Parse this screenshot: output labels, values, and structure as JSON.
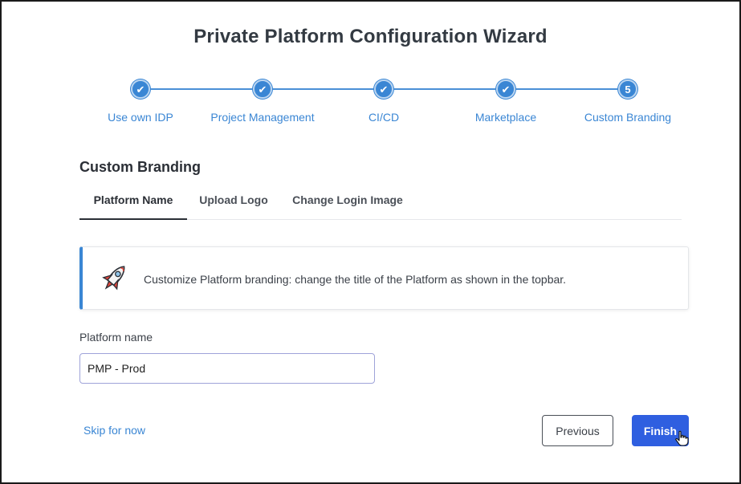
{
  "wizard": {
    "title": "Private Platform Configuration Wizard"
  },
  "steps": [
    {
      "label": "Use own IDP",
      "marker": "✔",
      "status": "completed"
    },
    {
      "label": "Project Management",
      "marker": "✔",
      "status": "completed"
    },
    {
      "label": "CI/CD",
      "marker": "✔",
      "status": "completed"
    },
    {
      "label": "Marketplace",
      "marker": "✔",
      "status": "completed"
    },
    {
      "label": "Custom Branding",
      "marker": "5",
      "status": "current"
    }
  ],
  "section": {
    "title": "Custom Branding"
  },
  "tabs": [
    {
      "label": "Platform Name",
      "active": true
    },
    {
      "label": "Upload Logo",
      "active": false
    },
    {
      "label": "Change Login Image",
      "active": false
    }
  ],
  "info": {
    "icon": "rocket-icon",
    "text": "Customize Platform branding: change the title of the Platform as shown in the topbar."
  },
  "form": {
    "platform_name_label": "Platform name",
    "platform_name_value": "PMP - Prod"
  },
  "footer": {
    "skip_label": "Skip for now",
    "previous_label": "Previous",
    "finish_label": "Finish"
  },
  "colors": {
    "accent": "#3a86d4",
    "primary_button": "#2f5fe0"
  }
}
